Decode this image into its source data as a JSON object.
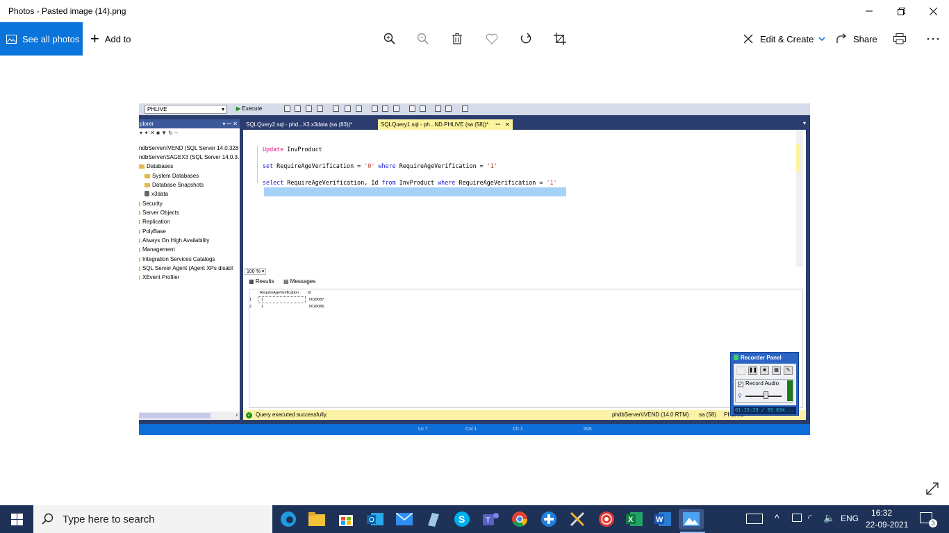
{
  "window": {
    "title": "Photos - Pasted image (14).png"
  },
  "toolbar": {
    "see_all_photos": "See all photos",
    "add_to": "Add to",
    "edit_create": "Edit & Create",
    "share": "Share"
  },
  "ssms": {
    "database": "PHLIVE",
    "execute": "Execute",
    "object_explorer_title": "plorer",
    "tree": [
      "ndbServer\\IVEND (SQL Server 14.0.328",
      "ndbServer\\SAGEX3 (SQL Server 14.0.3.",
      "Databases",
      "System Databases",
      "Database Snapshots",
      "x3data",
      "Security",
      "Server Objects",
      "Replication",
      "PolyBase",
      "Always On High Availability",
      "Management",
      "Integration Services Catalogs",
      "SQL Server Agent (Agent XPs disabl",
      "XEvent Profiler"
    ],
    "tabs": [
      "SQLQuery2.sql - phd...X3.x3data (sa (83))*",
      "SQLQuery1.sql - ph...ND.PHLIVE (sa (58))*"
    ],
    "code": {
      "line1_kw": "Update",
      "line1_rest": " InvProduct",
      "line2_kw": "set",
      "line2_a": " RequireAgeVerification = ",
      "line2_s1": "'0'",
      "line2_kw2": " where",
      "line2_b": " RequireAgeVerification = ",
      "line2_s2": "'1'",
      "line3_kw": "select",
      "line3_a": " RequireAgeVerification, Id ",
      "line3_kw2": "from",
      "line3_b": " InvProduct ",
      "line3_kw3": "where",
      "line3_c": " RequireAgeVerification = ",
      "line3_s": "'1'"
    },
    "zoom": "100 %",
    "results_tab": "Results",
    "messages_tab": "Messages",
    "grid": {
      "headers": [
        "RequireAgeVerification",
        "Id"
      ],
      "rows": [
        {
          "n": "1",
          "a": "1",
          "b": "0028087"
        },
        {
          "n": "2",
          "a": "1",
          "b": "0028086"
        }
      ]
    },
    "status": {
      "message": "Query executed successfully.",
      "server": "phdbServer\\IVEND (14.0 RTM)",
      "user": "sa (58)",
      "db": "PHLIVE"
    },
    "bottom": {
      "ln": "Ln 7",
      "col": "Col 1",
      "ch": "Ch 1",
      "ins": "INS"
    },
    "recorder": {
      "title": "Recorder Panel",
      "record_audio": "Record Audio",
      "time": "01:15:29 / 59.034..."
    }
  },
  "taskbar": {
    "search_placeholder": "Type here to search",
    "lang": "ENG",
    "time": "16:32",
    "date": "22-09-2021",
    "notifications": "3"
  },
  "colors": {
    "accent": "#0a74da",
    "taskbar": "#1e3258",
    "ssms_frame": "#2b3d6e",
    "status_bar": "#fbf2a6"
  }
}
